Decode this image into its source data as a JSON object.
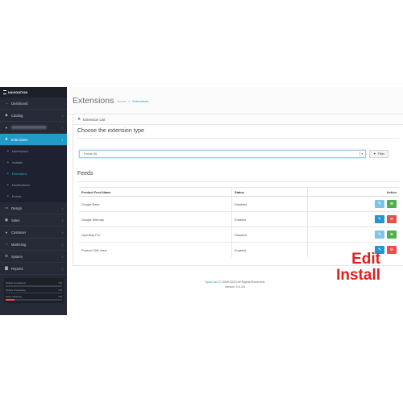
{
  "sidebar": {
    "header": "NAVIGATION",
    "items": [
      {
        "label": "Dashboard",
        "icon": "dashboard-icon",
        "glyph": "◔",
        "chev": ""
      },
      {
        "label": "Catalog",
        "icon": "tag-icon",
        "glyph": "◆",
        "chev": "›"
      },
      {
        "label": "",
        "icon": "puzzle-icon",
        "glyph": "●",
        "chev": "›"
      },
      {
        "label": "Extensions",
        "icon": "puzzle-icon",
        "glyph": "❖",
        "chev": "‹"
      }
    ],
    "sub_items": [
      {
        "label": "Marketplace"
      },
      {
        "label": "Installer"
      },
      {
        "label": "Extensions"
      },
      {
        "label": "Modifications"
      },
      {
        "label": "Events"
      }
    ],
    "items_after": [
      {
        "label": "Design",
        "icon": "monitor-icon",
        "glyph": "▭",
        "chev": "›"
      },
      {
        "label": "Sales",
        "icon": "cart-icon",
        "glyph": "▣",
        "chev": "›"
      },
      {
        "label": "Customer",
        "icon": "user-icon",
        "glyph": "●",
        "chev": "›"
      },
      {
        "label": "Marketing",
        "icon": "share-icon",
        "glyph": "∴",
        "chev": "›"
      },
      {
        "label": "System",
        "icon": "gear-icon",
        "glyph": "⚙",
        "chev": "›"
      },
      {
        "label": "Reports",
        "icon": "bar-chart-icon",
        "glyph": "▇",
        "chev": "›"
      }
    ],
    "stats": [
      {
        "label": "Orders Completed",
        "value": "0%",
        "fill": 0.0,
        "color": "#4cae4c"
      },
      {
        "label": "Orders Processing",
        "value": "0%",
        "fill": 0.0,
        "color": "#f0ad4e"
      },
      {
        "label": "Other Statuses",
        "value": "0%",
        "fill": 0.15,
        "color": "#e4504a"
      }
    ]
  },
  "header": {
    "title": "Extensions",
    "breadcrumb_home": "Home",
    "breadcrumb_sep": "»",
    "breadcrumb_current": "Extensions"
  },
  "panel": {
    "title": "Extension List",
    "choose_label": "Choose the extension type",
    "select_value": "Feeds (4)",
    "filter_label": "Filter",
    "feeds_label": "Feeds"
  },
  "table": {
    "headers": [
      "Product Feed Name",
      "Status",
      "Action"
    ],
    "rows": [
      {
        "name": "Google Base",
        "status": "Disabled",
        "installed": false
      },
      {
        "name": "Google Sitemap",
        "status": "Enabled",
        "installed": true
      },
      {
        "name": "OpenBay Pro",
        "status": "Disabled",
        "installed": false
      },
      {
        "name": "Product XML feed",
        "status": "Enabled",
        "installed": true
      }
    ]
  },
  "footer": {
    "brand": "OpenCart",
    "copyright": "© 2009-2020 All Rights Reserved.",
    "version": "Version 3.0.3.6"
  },
  "annotations": {
    "edit": "Edit",
    "install": "Install"
  },
  "colors": {
    "accent": "#229ac8",
    "sidebar_bg": "#252a36",
    "install_green": "#4cae4c",
    "uninstall_red": "#e4504a",
    "annotation_red": "#e02020"
  }
}
